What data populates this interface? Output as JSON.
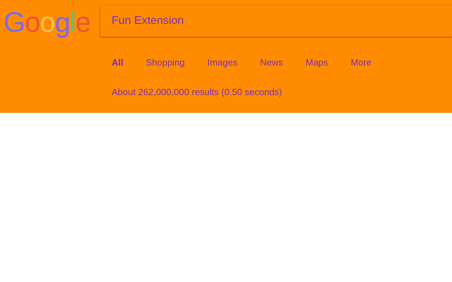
{
  "logo": {
    "letters": [
      "G",
      "o",
      "o",
      "g",
      "l",
      "e"
    ],
    "colors": [
      "#7b68ee",
      "#e8543a",
      "#f2c14e",
      "#7b68ee",
      "#58c27d",
      "#e8543a"
    ]
  },
  "search": {
    "value": "Fun Extension"
  },
  "tabs": [
    {
      "label": "All",
      "active": true
    },
    {
      "label": "Shopping",
      "active": false
    },
    {
      "label": "Images",
      "active": false
    },
    {
      "label": "News",
      "active": false
    },
    {
      "label": "Maps",
      "active": false
    },
    {
      "label": "More",
      "active": false
    }
  ],
  "result_stats": "About 262,000,000 results (0.50 seconds)",
  "colors": {
    "header_background": "#ff8c00",
    "text": "#7b2cbf",
    "page_background": "#ffffff"
  }
}
